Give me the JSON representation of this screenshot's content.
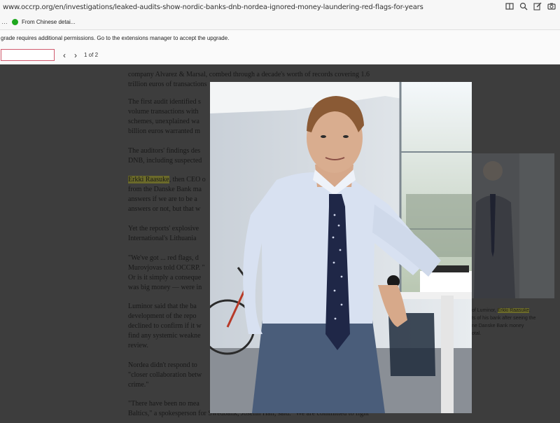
{
  "browser": {
    "url": "www.occrp.org/en/investigations/leaked-audits-show-nordic-banks-dnb-nordea-ignored-money-laundering-red-flags-for-years",
    "bookmark_ellipsis": "…",
    "bookmark_label": "From Chinese detai...",
    "notice": "grade requires additional permissions. Go to the extensions manager to accept the upgrade.",
    "find": {
      "value": "",
      "prev": "‹",
      "next": "›",
      "count": "1 of 2"
    }
  },
  "article": {
    "paragraphs": [
      "company Alvarez & Marsal, combed through a decade's worth of records covering 1.6",
      "trillion euros of transactions",
      "The first audit identified s",
      "volume transactions with",
      "schemes, unexplained wa",
      "billion euros warranted m",
      "The auditors' findings des",
      "DNB, including suspected",
      "then CEO o",
      "from the Danske Bank ma",
      "answers if we are to be a",
      "answers or not, but that w",
      "Yet the reports' explosive",
      "International's Lithuania",
      "\"We've got ... red flags, d",
      "Murovjovas told OCCRP. \"",
      "Or is it simply a conseque",
      "was big money — were in",
      "Luminor said that the ba",
      "development of the repo",
      "declined to confirm if it w",
      "find any systemic weakne",
      "review.",
      "Nordea didn't respond to",
      "\"closer collaboration betw",
      "crime.\"",
      "\"There have been no mea",
      "Baltics,\" a spokesperson for Swedbank, Josefin Hall, said. \"We are committed to fight"
    ],
    "highlight_name": "Erkki Raasuke",
    "caption": {
      "line1_prefix": "of Luminor,",
      "line2": "ts of his bank after seeing the",
      "line3": "ne Danske Bank money",
      "line4": "otal."
    }
  }
}
